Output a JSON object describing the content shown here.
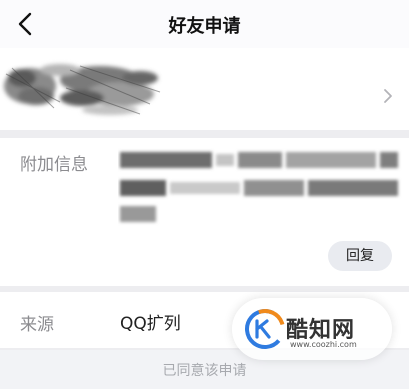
{
  "header": {
    "title": "好友申请"
  },
  "icons": {
    "back": "chevron-left-icon",
    "profile_chevron": "chevron-right-icon"
  },
  "info": {
    "label": "附加信息",
    "reply_label": "回复"
  },
  "source": {
    "label": "来源",
    "value": "QQ扩列"
  },
  "status": {
    "text": "已同意该申请"
  },
  "watermark": {
    "name": "酷知网",
    "url": "www.coozhi.com"
  },
  "colors": {
    "accent_blue": "#2f7be0",
    "accent_orange": "#f08a1c",
    "label_gray": "#8c8c90",
    "status_gray": "#a7a9ae"
  }
}
